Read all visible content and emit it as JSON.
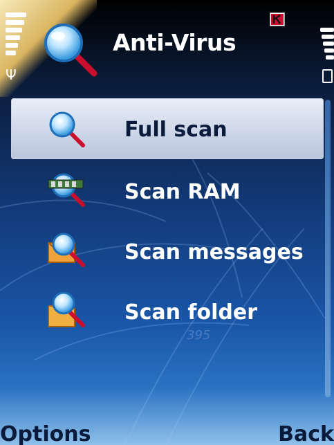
{
  "status_bar": {
    "signal_icon": "signal-strength-icon",
    "battery_icon": "battery-icon",
    "app_badge_icon": "kaspersky-k-icon"
  },
  "header": {
    "icon": "magnifier-icon",
    "title": "Anti-Virus"
  },
  "menu": {
    "items": [
      {
        "label": "Full scan",
        "icon": "full-scan-magnifier-icon",
        "selected": true
      },
      {
        "label": "Scan RAM",
        "icon": "scan-ram-icon",
        "selected": false
      },
      {
        "label": "Scan messages",
        "icon": "scan-messages-icon",
        "selected": false
      },
      {
        "label": "Scan folder",
        "icon": "scan-folder-icon",
        "selected": false
      }
    ]
  },
  "softkeys": {
    "left": "Options",
    "right": "Back"
  },
  "colors": {
    "selection_bg": "#d0d9ea",
    "background_top": "#000000",
    "background_bottom": "#2a73c2",
    "icon_red": "#c8102e"
  }
}
